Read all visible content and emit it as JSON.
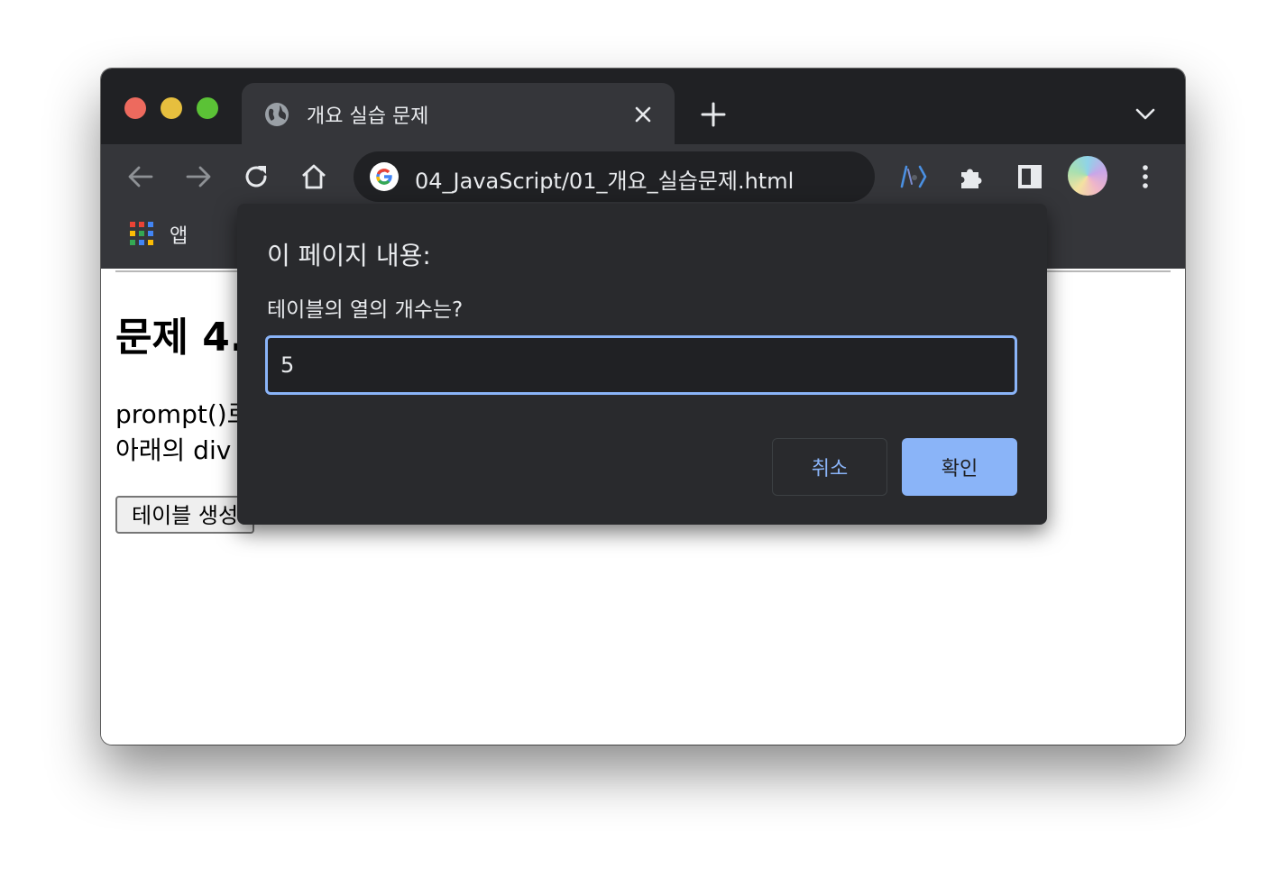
{
  "browser": {
    "tab": {
      "title": "개요 실습 문제",
      "icon": "globe-icon"
    },
    "address_bar": {
      "url": "04_JavaScript/01_개요_실습문제.html"
    },
    "bookmarks": {
      "apps_label": "앱"
    },
    "colors": {
      "frame": "#202124",
      "toolbar": "#35363a",
      "accent": "#8ab4f8"
    }
  },
  "page": {
    "heading": "문제 4.",
    "paragraph_line1": "prompt()로",
    "paragraph_line2": "아래의 div",
    "button_label": "테이블 생성"
  },
  "dialog": {
    "title": "이 페이지 내용:",
    "message": "테이블의 열의 개수는?",
    "input_value": "5",
    "cancel_label": "취소",
    "ok_label": "확인"
  }
}
